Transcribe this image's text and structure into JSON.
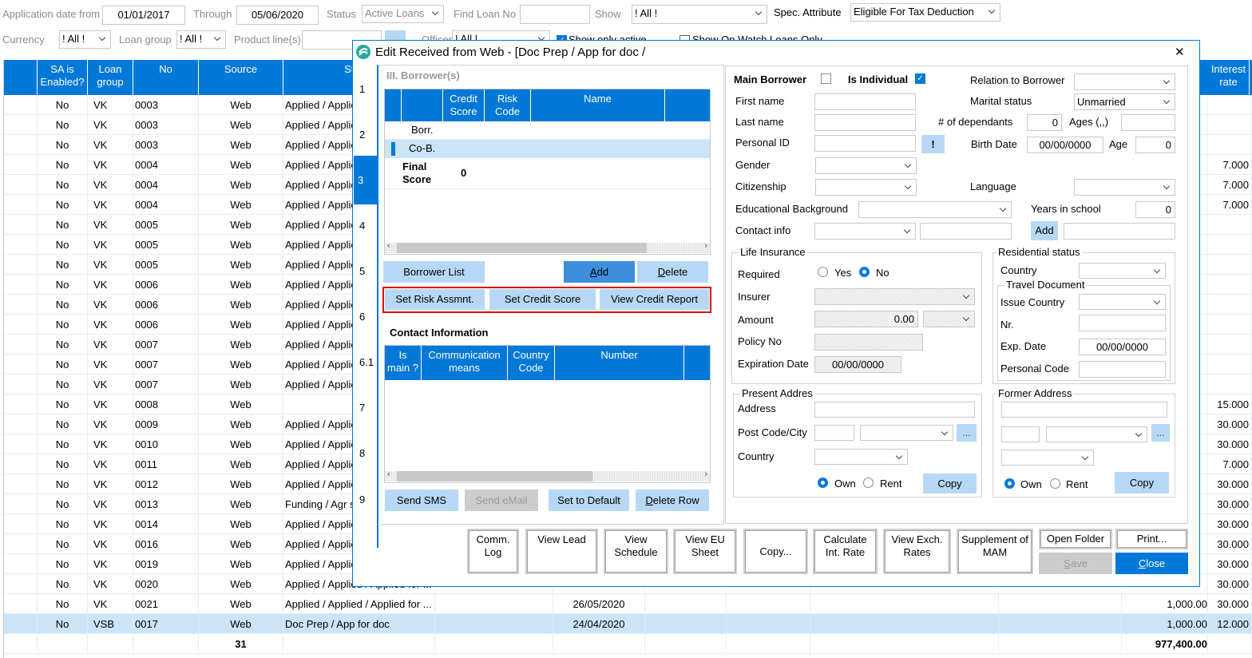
{
  "filters": {
    "app_date_from_label": "Application date from",
    "app_date_from": "01/01/2017",
    "through_label": "Through",
    "through": "05/06/2020",
    "status_label": "Status",
    "status": "Active Loans",
    "find_loan_label": "Find Loan No",
    "find_loan_value": "",
    "show_label": "Show",
    "show": "! All !",
    "spec_attr_label": "Spec. Attribute",
    "spec_attr": "Eligible For Tax Deduction",
    "currency_label": "Currency",
    "currency": "! All !",
    "loan_group_label": "Loan group",
    "loan_group": "! All !",
    "product_lines_label": "Product line(s)",
    "officer_label": "Officer",
    "officer": "! All !",
    "show_only_active_label": "Show only active",
    "show_only_active": true,
    "watch_loans_label": "Show On Watch Loans Only",
    "watch_loans": false
  },
  "table": {
    "headers": {
      "sa": "SA is Enabled?",
      "group": "Loan group",
      "no": "No",
      "source": "Source",
      "status": "Status",
      "rate": "Interest rate"
    },
    "rows": [
      {
        "sa": "No",
        "group": "VK",
        "no": "0003",
        "source": "Web",
        "status": "Applied / Applied / Applied for ...",
        "date": "",
        "amount": "",
        "rate": ""
      },
      {
        "sa": "No",
        "group": "VK",
        "no": "0003",
        "source": "Web",
        "status": "Applied / Applied / Applied for ...",
        "date": "",
        "amount": "",
        "rate": ""
      },
      {
        "sa": "No",
        "group": "VK",
        "no": "0003",
        "source": "Web",
        "status": "Applied / Applied / Applied for ...",
        "date": "",
        "amount": "",
        "rate": ""
      },
      {
        "sa": "No",
        "group": "VK",
        "no": "0004",
        "source": "Web",
        "status": "Applied / Applied / Applied for ...",
        "date": "",
        "amount": "",
        "rate": "7.000"
      },
      {
        "sa": "No",
        "group": "VK",
        "no": "0004",
        "source": "Web",
        "status": "Applied / Applied / Applied for ...",
        "date": "",
        "amount": "",
        "rate": "7.000"
      },
      {
        "sa": "No",
        "group": "VK",
        "no": "0004",
        "source": "Web",
        "status": "Applied / Applied / Applied for ...",
        "date": "",
        "amount": "",
        "rate": "7.000"
      },
      {
        "sa": "No",
        "group": "VK",
        "no": "0005",
        "source": "Web",
        "status": "Applied / Applied / Applied for ...",
        "date": "",
        "amount": "",
        "rate": ""
      },
      {
        "sa": "No",
        "group": "VK",
        "no": "0005",
        "source": "Web",
        "status": "Applied / Applied / Applied for ...",
        "date": "",
        "amount": "",
        "rate": ""
      },
      {
        "sa": "No",
        "group": "VK",
        "no": "0005",
        "source": "Web",
        "status": "Applied / Applied / Applied for ...",
        "date": "",
        "amount": "",
        "rate": ""
      },
      {
        "sa": "No",
        "group": "VK",
        "no": "0006",
        "source": "Web",
        "status": "Applied / Applied / Applied for ...",
        "date": "",
        "amount": "",
        "rate": ""
      },
      {
        "sa": "No",
        "group": "VK",
        "no": "0006",
        "source": "Web",
        "status": "Applied / Applied / Applied for ...",
        "date": "",
        "amount": "",
        "rate": ""
      },
      {
        "sa": "No",
        "group": "VK",
        "no": "0006",
        "source": "Web",
        "status": "Applied / Applied / Applied for ...",
        "date": "",
        "amount": "",
        "rate": ""
      },
      {
        "sa": "No",
        "group": "VK",
        "no": "0007",
        "source": "Web",
        "status": "Applied / Applied / Applied for ...",
        "date": "",
        "amount": "",
        "rate": ""
      },
      {
        "sa": "No",
        "group": "VK",
        "no": "0007",
        "source": "Web",
        "status": "Applied / Applied / Applied for ...",
        "date": "",
        "amount": "",
        "rate": ""
      },
      {
        "sa": "No",
        "group": "VK",
        "no": "0007",
        "source": "Web",
        "status": "Applied / Applied / Applied for ...",
        "date": "",
        "amount": "",
        "rate": ""
      },
      {
        "sa": "No",
        "group": "VK",
        "no": "0008",
        "source": "Web",
        "status": "",
        "date": "",
        "amount": "",
        "rate": "15.000"
      },
      {
        "sa": "No",
        "group": "VK",
        "no": "0009",
        "source": "Web",
        "status": "Applied / Applied / Applied for ...",
        "date": "",
        "amount": "",
        "rate": "30.000"
      },
      {
        "sa": "No",
        "group": "VK",
        "no": "0010",
        "source": "Web",
        "status": "Applied / Applied / Applied for ...",
        "date": "",
        "amount": "",
        "rate": "30.000"
      },
      {
        "sa": "No",
        "group": "VK",
        "no": "0011",
        "source": "Web",
        "status": "Applied / Applied / Applied for ...",
        "date": "",
        "amount": "",
        "rate": "7.000"
      },
      {
        "sa": "No",
        "group": "VK",
        "no": "0012",
        "source": "Web",
        "status": "Applied / Applied / Applied for ...",
        "date": "",
        "amount": "",
        "rate": "30.000"
      },
      {
        "sa": "No",
        "group": "VK",
        "no": "0013",
        "source": "Web",
        "status": "Funding / Agr signed",
        "date": "",
        "amount": "",
        "rate": "30.000"
      },
      {
        "sa": "No",
        "group": "VK",
        "no": "0014",
        "source": "Web",
        "status": "Applied / Applied / Applied for ...",
        "date": "",
        "amount": "",
        "rate": "30.000"
      },
      {
        "sa": "No",
        "group": "VK",
        "no": "0016",
        "source": "Web",
        "status": "Applied / Applied / Applied for ...",
        "date": "",
        "amount": "",
        "rate": "30.000"
      },
      {
        "sa": "No",
        "group": "VK",
        "no": "0019",
        "source": "Web",
        "status": "Applied / Applied / Applied for ...",
        "date": "",
        "amount": "",
        "rate": "30.000"
      },
      {
        "sa": "No",
        "group": "VK",
        "no": "0020",
        "source": "Web",
        "status": "Applied / Applied / Applied for ...",
        "date": "",
        "amount": "",
        "rate": "30.000"
      },
      {
        "sa": "No",
        "group": "VK",
        "no": "0021",
        "source": "Web",
        "status": "Applied / Applied / Applied for ...",
        "date": "26/05/2020",
        "amount": "1,000.00",
        "rate": "30.000"
      },
      {
        "sa": "No",
        "group": "VSB",
        "no": "0017",
        "source": "Web",
        "status": "Doc Prep / App for doc",
        "date": "24/04/2020",
        "amount": "1,000.00",
        "rate": "12.000",
        "selected": true
      }
    ],
    "total_count": "31",
    "total_amount": "977,400.00"
  },
  "dialog": {
    "title": "Edit Received from Web - [Doc Prep / App for doc /",
    "close_glyph": "✕",
    "nav_items": [
      "1",
      "2",
      "3",
      "4",
      "5",
      "6",
      "6.1",
      "7",
      "8",
      "9"
    ],
    "nav_active": "3",
    "borrowers": {
      "section_title": "III. Borrower(s)",
      "headers": {
        "credit": "Credit Score",
        "risk": "Risk Code",
        "name": "Name"
      },
      "rows": [
        "Borr.",
        "Co-B."
      ],
      "final_label": "Final Score",
      "final_value": "0",
      "borrower_list": "Borrower List",
      "add": "Add",
      "delete": "Delete",
      "set_risk": "Set Risk Assmnt.",
      "set_credit": "Set Credit Score",
      "view_credit": "View Credit Report"
    },
    "contact": {
      "title": "Contact Information",
      "headers": {
        "is_main": "Is main ?",
        "means": "Communication means",
        "code": "Country Code",
        "number": "Number"
      },
      "send_sms": "Send SMS",
      "send_email": "Send eMail",
      "set_default": "Set to Default",
      "delete_row": "Delete Row"
    },
    "person": {
      "main_borrower": "Main Borrower",
      "main_borrower_checked": false,
      "is_individual": "Is Individual",
      "is_individual_checked": true,
      "relation_label": "Relation to Borrower",
      "relation": "",
      "first_name_label": "First name",
      "first_name": "",
      "marital_label": "Marital status",
      "marital": "Unmarried",
      "last_name_label": "Last name",
      "last_name": "",
      "dependants_label": "# of dependants",
      "dependants": "0",
      "ages_label": "Ages (,,)",
      "ages": "",
      "personal_id_label": "Personal ID",
      "personal_id": "",
      "id_check_button": "!",
      "birth_label": "Birth Date",
      "birth": "00/00/0000",
      "age_label": "Age",
      "age": "0",
      "gender_label": "Gender",
      "citizenship_label": "Citizenship",
      "language_label": "Language",
      "education_label": "Educational Background",
      "years_school_label": "Years in school",
      "years_school": "0",
      "contact_label": "Contact info",
      "contact_add": "Add"
    },
    "life": {
      "title": "Life Insurance",
      "required_label": "Required",
      "yes": "Yes",
      "no": "No",
      "required": "No",
      "insurer_label": "Insurer",
      "amount_label": "Amount",
      "amount": "0.00",
      "policy_label": "Policy No",
      "expiration_label": "Expiration Date",
      "expiration": "00/00/0000"
    },
    "residential": {
      "title": "Residential status",
      "country_label": "Country",
      "travel_title": "Travel Document",
      "issue_country_label": "Issue Country",
      "nr_label": "Nr.",
      "exp_label": "Exp. Date",
      "exp": "00/00/0000",
      "personal_code_label": "Personal Code"
    },
    "present": {
      "title": "Present Addres",
      "address_label": "Address",
      "post_label": "Post Code/City",
      "country_label": "Country",
      "browse": "...",
      "own": "Own",
      "rent": "Rent",
      "selected": "Own",
      "copy": "Copy"
    },
    "former": {
      "title": "Former Address",
      "browse": "...",
      "own": "Own",
      "rent": "Rent",
      "selected": "Own",
      "copy": "Copy"
    },
    "footer": {
      "comm_log": "Comm. Log",
      "view_lead": "View Lead",
      "view_schedule": "View Schedule",
      "view_eu": "View EU Sheet",
      "copy": "Copy...",
      "calc_rate": "Calculate Int. Rate",
      "view_exch": "View Exch. Rates",
      "supplement": "Supplement of MAM",
      "open_folder": "Open Folder",
      "print": "Print...",
      "save": "Save",
      "close": "Close"
    }
  },
  "colors": {
    "accent": "#0078d7",
    "button": "#b7d8f4",
    "selected_row": "#cce4f7",
    "highlight_border": "#e00000"
  }
}
